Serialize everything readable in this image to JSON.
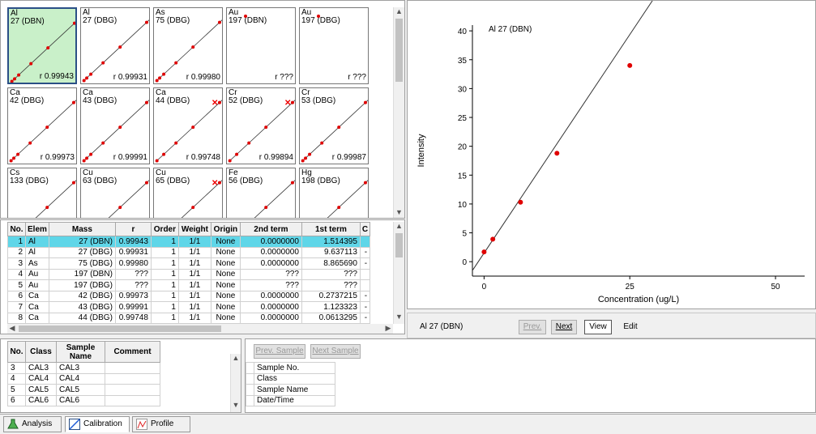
{
  "thumbnails": [
    {
      "element": "Al",
      "mass": "27 (DBN)",
      "r": "r 0.99943",
      "selected": true,
      "outliers": []
    },
    {
      "element": "Al",
      "mass": "27 (DBG)",
      "r": "r 0.99931",
      "selected": false,
      "outliers": []
    },
    {
      "element": "As",
      "mass": "75 (DBG)",
      "r": "r 0.99980",
      "selected": false,
      "outliers": []
    },
    {
      "element": "Au",
      "mass": "197 (DBN)",
      "r": "r ???",
      "selected": false,
      "outliers": [],
      "no_curve": true
    },
    {
      "element": "Au",
      "mass": "197 (DBG)",
      "r": "r ???",
      "selected": false,
      "outliers": [],
      "no_curve": true
    },
    {
      "element": "Ca",
      "mass": "42 (DBG)",
      "r": "r 0.99973",
      "selected": false,
      "outliers": []
    },
    {
      "element": "Ca",
      "mass": "43 (DBG)",
      "r": "r 0.99991",
      "selected": false,
      "outliers": []
    },
    {
      "element": "Ca",
      "mass": "44 (DBG)",
      "r": "r 0.99748",
      "selected": false,
      "outliers": [
        1
      ]
    },
    {
      "element": "Cr",
      "mass": "52 (DBG)",
      "r": "r 0.99894",
      "selected": false,
      "outliers": [
        1
      ]
    },
    {
      "element": "Cr",
      "mass": "53 (DBG)",
      "r": "r 0.99987",
      "selected": false,
      "outliers": []
    },
    {
      "element": "Cs",
      "mass": "133 (DBG)",
      "r": "",
      "selected": false,
      "outliers": []
    },
    {
      "element": "Cu",
      "mass": "63 (DBG)",
      "r": "",
      "selected": false,
      "outliers": []
    },
    {
      "element": "Cu",
      "mass": "65 (DBG)",
      "r": "",
      "selected": false,
      "outliers": [
        1
      ]
    },
    {
      "element": "Fe",
      "mass": "56 (DBG)",
      "r": "",
      "selected": false,
      "outliers": []
    },
    {
      "element": "Hg",
      "mass": "198 (DBG)",
      "r": "",
      "selected": false,
      "outliers": []
    }
  ],
  "calib_table": {
    "headers": [
      "No.",
      "Elem",
      "Mass",
      "r",
      "Order",
      "Weight",
      "Origin",
      "2nd term",
      "1st term",
      "C"
    ],
    "rows": [
      [
        "1",
        "Al",
        "27 (DBN)",
        "0.99943",
        "1",
        "1/1",
        "None",
        "0.0000000",
        "1.514395",
        ""
      ],
      [
        "2",
        "Al",
        "27 (DBG)",
        "0.99931",
        "1",
        "1/1",
        "None",
        "0.0000000",
        "9.637113",
        "-"
      ],
      [
        "3",
        "As",
        "75 (DBG)",
        "0.99980",
        "1",
        "1/1",
        "None",
        "0.0000000",
        "8.865690",
        "-"
      ],
      [
        "4",
        "Au",
        "197 (DBN)",
        "???",
        "1",
        "1/1",
        "None",
        "???",
        "???",
        ""
      ],
      [
        "5",
        "Au",
        "197 (DBG)",
        "???",
        "1",
        "1/1",
        "None",
        "???",
        "???",
        ""
      ],
      [
        "6",
        "Ca",
        "42 (DBG)",
        "0.99973",
        "1",
        "1/1",
        "None",
        "0.0000000",
        "0.2737215",
        "-"
      ],
      [
        "7",
        "Ca",
        "43 (DBG)",
        "0.99991",
        "1",
        "1/1",
        "None",
        "0.0000000",
        "1.123323",
        "-"
      ],
      [
        "8",
        "Ca",
        "44 (DBG)",
        "0.99748",
        "1",
        "1/1",
        "None",
        "0.0000000",
        "0.0613295",
        "-"
      ]
    ],
    "selected_row": 0
  },
  "chart_data": {
    "type": "scatter",
    "title": "Al 27 (DBN)",
    "xlabel": "Concentration (ug/L)",
    "ylabel": "Intensity",
    "xlim": [
      -2,
      55
    ],
    "ylim": [
      -2.5,
      41
    ],
    "xticks": [
      0,
      25,
      50
    ],
    "yticks": [
      0,
      5,
      10,
      15,
      20,
      25,
      30,
      35,
      40
    ],
    "points": [
      {
        "x": 0,
        "y": 1.7
      },
      {
        "x": 1.5,
        "y": 3.9
      },
      {
        "x": 6.25,
        "y": 10.3
      },
      {
        "x": 12.5,
        "y": 18.8
      },
      {
        "x": 25,
        "y": 34.0
      }
    ],
    "fit_line": {
      "slope": 1.514395,
      "intercept": 1.5
    },
    "grid": false,
    "marker_color": "#e00000"
  },
  "plot_status": {
    "label": "Al 27 (DBN)",
    "prev_label": "Prev.",
    "next_label": "Next",
    "view_label": "View",
    "edit_label": "Edit"
  },
  "sample_table": {
    "headers": [
      "No.",
      "Class",
      "Sample\nName",
      "Comment"
    ],
    "rows": [
      [
        "3",
        "CAL3",
        "CAL3",
        ""
      ],
      [
        "4",
        "CAL4",
        "CAL4",
        ""
      ],
      [
        "5",
        "CAL5",
        "CAL5",
        ""
      ],
      [
        "6",
        "CAL6",
        "CAL6",
        ""
      ]
    ]
  },
  "detail": {
    "prev_sample": "Prev. Sample",
    "next_sample": "Next Sample",
    "fields": [
      "Sample No.",
      "Class",
      "Sample Name",
      "Date/Time"
    ]
  },
  "tabs": [
    {
      "label": "Analysis",
      "icon": "flask-icon"
    },
    {
      "label": "Calibration C...",
      "icon": "calibration-curve-icon"
    },
    {
      "label": "Profile",
      "icon": "profile-chart-icon"
    }
  ],
  "colors": {
    "selected_thumb_bg": "#c9f0c9",
    "selected_row_bg": "#5fd6e8",
    "point": "#e00000"
  }
}
